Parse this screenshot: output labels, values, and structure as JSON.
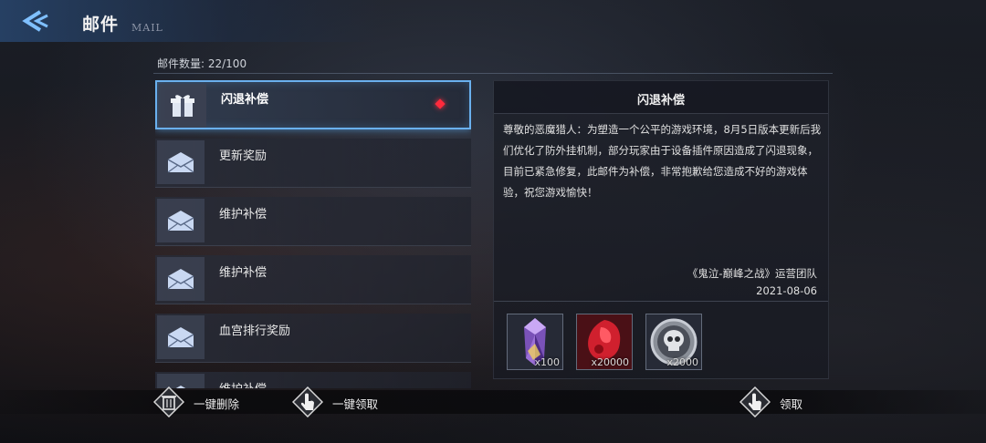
{
  "header": {
    "title": "邮件",
    "subtitle": "MAIL",
    "back_icon": "back-arrow-icon",
    "accent": "#5aa8f0"
  },
  "mail_count": "邮件数量: 22/100",
  "mails": [
    {
      "label": "闪退补偿",
      "icon": "gift-icon",
      "selected": true,
      "unread": true
    },
    {
      "label": "更新奖励",
      "icon": "envelope-icon"
    },
    {
      "label": "维护补偿",
      "icon": "envelope-icon"
    },
    {
      "label": "维护补偿",
      "icon": "envelope-icon"
    },
    {
      "label": "血宫排行奖励",
      "icon": "envelope-icon"
    },
    {
      "label": "维护补偿",
      "icon": "envelope-icon"
    }
  ],
  "detail": {
    "title": "闪退补偿",
    "body": "尊敬的恶魔猎人：为塑造一个公平的游戏环境，8月5日版本更新后我们优化了防外挂机制，部分玩家由于设备插件原因造成了闪退现象，目前已紧急修复，此邮件为补偿，非常抱歉给您造成不好的游戏体验，祝您游戏愉快！",
    "signature": "《鬼泣-巅峰之战》运营团队",
    "date": "2021-08-06",
    "rewards": [
      {
        "icon": "purple-crystal-icon",
        "qty": "x100"
      },
      {
        "icon": "red-gem-icon",
        "qty": "x20000"
      },
      {
        "icon": "skull-coin-icon",
        "qty": "x2000"
      }
    ]
  },
  "actions": {
    "delete_all": "一键删除",
    "claim_all": "一键领取",
    "claim": "领取"
  },
  "colors": {
    "selected_border": "#6ab0ee",
    "unread_dot": "#ff2a3c"
  }
}
